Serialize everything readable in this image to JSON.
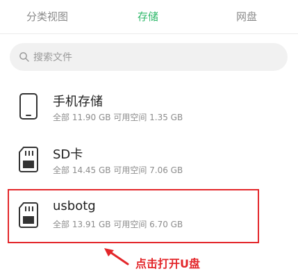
{
  "tabs": [
    {
      "label": "分类视图"
    },
    {
      "label": "存储"
    },
    {
      "label": "网盘"
    }
  ],
  "active_color": "#2fb86a",
  "search": {
    "placeholder": "搜索文件",
    "icon": "search-icon"
  },
  "storage": [
    {
      "name": "手机存储",
      "detail": "全部 11.90 GB 可用空间 1.35 GB",
      "icon": "phone-icon"
    },
    {
      "name": "SD卡",
      "detail": "全部 14.45 GB 可用空间 7.06 GB",
      "icon": "sd-card-icon"
    },
    {
      "name": "usbotg",
      "detail": "全部 13.91 GB 可用空间 6.70 GB",
      "icon": "usb-storage-icon"
    }
  ],
  "annotation": {
    "text": "点击打开U盘",
    "color": "#e3262a"
  }
}
